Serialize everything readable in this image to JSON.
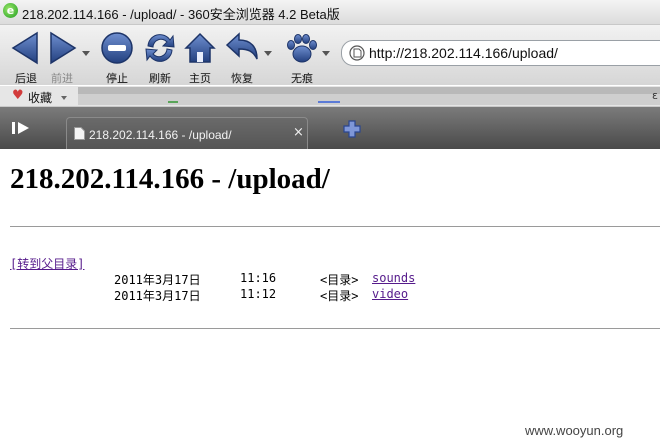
{
  "window": {
    "title": "218.202.114.166 - /upload/ - 360安全浏览器 4.2 Beta版",
    "app_icon_letter": "e"
  },
  "toolbar": {
    "back": "后退",
    "forward": "前进",
    "stop": "停止",
    "refresh": "刷新",
    "home": "主页",
    "restore": "恢复",
    "incognito": "无痕"
  },
  "address": {
    "url": "http://218.202.114.166/upload/"
  },
  "favorites": {
    "label": "收藏",
    "right_char": "ε"
  },
  "tab": {
    "title": "218.202.114.166 - /upload/",
    "close": "×"
  },
  "page": {
    "heading": "218.202.114.166 - /upload/",
    "parent_link": "[转到父目录]",
    "entries": [
      {
        "date": "2011年3月17日",
        "time": "11:16",
        "type": "<目录>",
        "name": "sounds"
      },
      {
        "date": "2011年3月17日",
        "time": "11:12",
        "type": "<目录>",
        "name": "video"
      }
    ]
  },
  "watermark": "www.wooyun.org",
  "colors": {
    "link_visited": "#551a8b",
    "tab_bar": "#5a5a5a",
    "toolbar_icon": "#3b5fa8"
  }
}
